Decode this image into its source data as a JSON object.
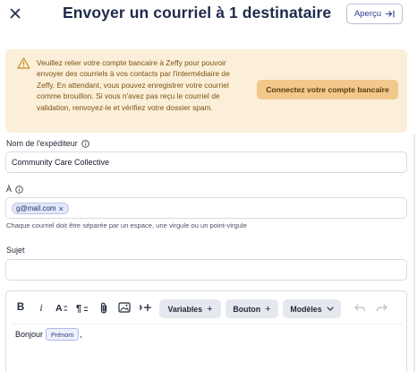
{
  "header": {
    "title": "Envoyer un courriel à 1 destinataire",
    "preview_label": "Aperçu",
    "close_icon": "close-icon",
    "preview_icon": "arrow-right-to-line-icon"
  },
  "alert": {
    "message": "Veuillez relier votre compte bancaire à Zeffy pour pouvoir envoyer des courriels à vos contacts par l'intermédiaire de Zeffy. En attendant, vous pouvez enregistrer votre courriel comme brouillon. Si vous n'avez pas reçu le courriel de validation, renvoyez-le et vérifiez votre dossier spam.",
    "button_label": "Connectez votre compte bancaire",
    "icon": "warning-triangle-icon",
    "background": "#fcefd9",
    "text_color": "#7a5313"
  },
  "sender": {
    "label": "Nom de l'expéditeur",
    "value": "Community Care Collective",
    "info_icon": "info-icon"
  },
  "recipient": {
    "label": "À",
    "chip": "g@mail.com",
    "helper": "Chaque courriel doit être séparée par un espace, une virgule ou un point-virgule",
    "info_icon": "info-icon"
  },
  "subject": {
    "label": "Sujet",
    "value": ""
  },
  "editor": {
    "toolbar": {
      "bold": "B",
      "italic": "i",
      "variables_label": "Variables",
      "button_label": "Bouton",
      "models_label": "Modèles",
      "plus": "+"
    },
    "body_text": "Bonjour",
    "variable_tag": "Prénom",
    "trailing": ","
  },
  "colors": {
    "primary": "#1e2a4a",
    "accent": "#2e3a8c",
    "alert_button": "#f2c88d"
  }
}
